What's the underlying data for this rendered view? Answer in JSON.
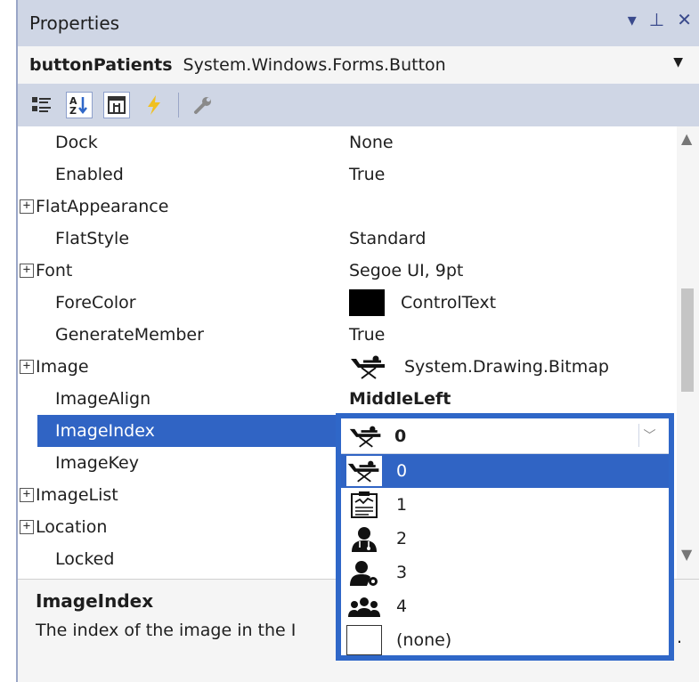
{
  "window": {
    "title": "Properties",
    "icons": [
      "dropdown-arrow-icon",
      "pin-icon",
      "close-icon"
    ]
  },
  "object_selector": {
    "name": "buttonPatients",
    "type": "System.Windows.Forms.Button"
  },
  "toolbar": {
    "buttons": [
      "categorized-icon",
      "alphabetical-icon",
      "properties-icon",
      "events-icon",
      "property-pages-icon"
    ]
  },
  "properties": [
    {
      "name": "Dock",
      "value": "None",
      "expandable": false
    },
    {
      "name": "Enabled",
      "value": "True",
      "expandable": false
    },
    {
      "name": "FlatAppearance",
      "value": "",
      "expandable": true
    },
    {
      "name": "FlatStyle",
      "value": "Standard",
      "expandable": false
    },
    {
      "name": "Font",
      "value": "Segoe UI, 9pt",
      "expandable": true
    },
    {
      "name": "ForeColor",
      "value": "ControlText",
      "expandable": false
    },
    {
      "name": "GenerateMember",
      "value": "True",
      "expandable": false
    },
    {
      "name": "Image",
      "value": "System.Drawing.Bitmap",
      "expandable": true
    },
    {
      "name": "ImageAlign",
      "value": "MiddleLeft",
      "expandable": false
    },
    {
      "name": "ImageIndex",
      "value": "0",
      "expandable": false
    },
    {
      "name": "ImageKey",
      "value": "",
      "expandable": false
    },
    {
      "name": "ImageList",
      "value": "",
      "expandable": true
    },
    {
      "name": "Location",
      "value": "",
      "expandable": true
    },
    {
      "name": "Locked",
      "value": "",
      "expandable": false
    }
  ],
  "dropdown": {
    "current": "0",
    "items": [
      {
        "label": "0",
        "icon": "stretcher-icon"
      },
      {
        "label": "1",
        "icon": "clipboard-chart-icon"
      },
      {
        "label": "2",
        "icon": "doctor-icon"
      },
      {
        "label": "3",
        "icon": "user-settings-icon"
      },
      {
        "label": "4",
        "icon": "group-icon"
      },
      {
        "label": "(none)",
        "icon": "blank-icon"
      }
    ]
  },
  "description": {
    "title": "ImageIndex",
    "text": "The index of the image in the I",
    "trailing": "."
  },
  "colors": {
    "selection": "#3064c4",
    "header": "#cfd6e5",
    "dropdown_border": "#2f67c8"
  }
}
